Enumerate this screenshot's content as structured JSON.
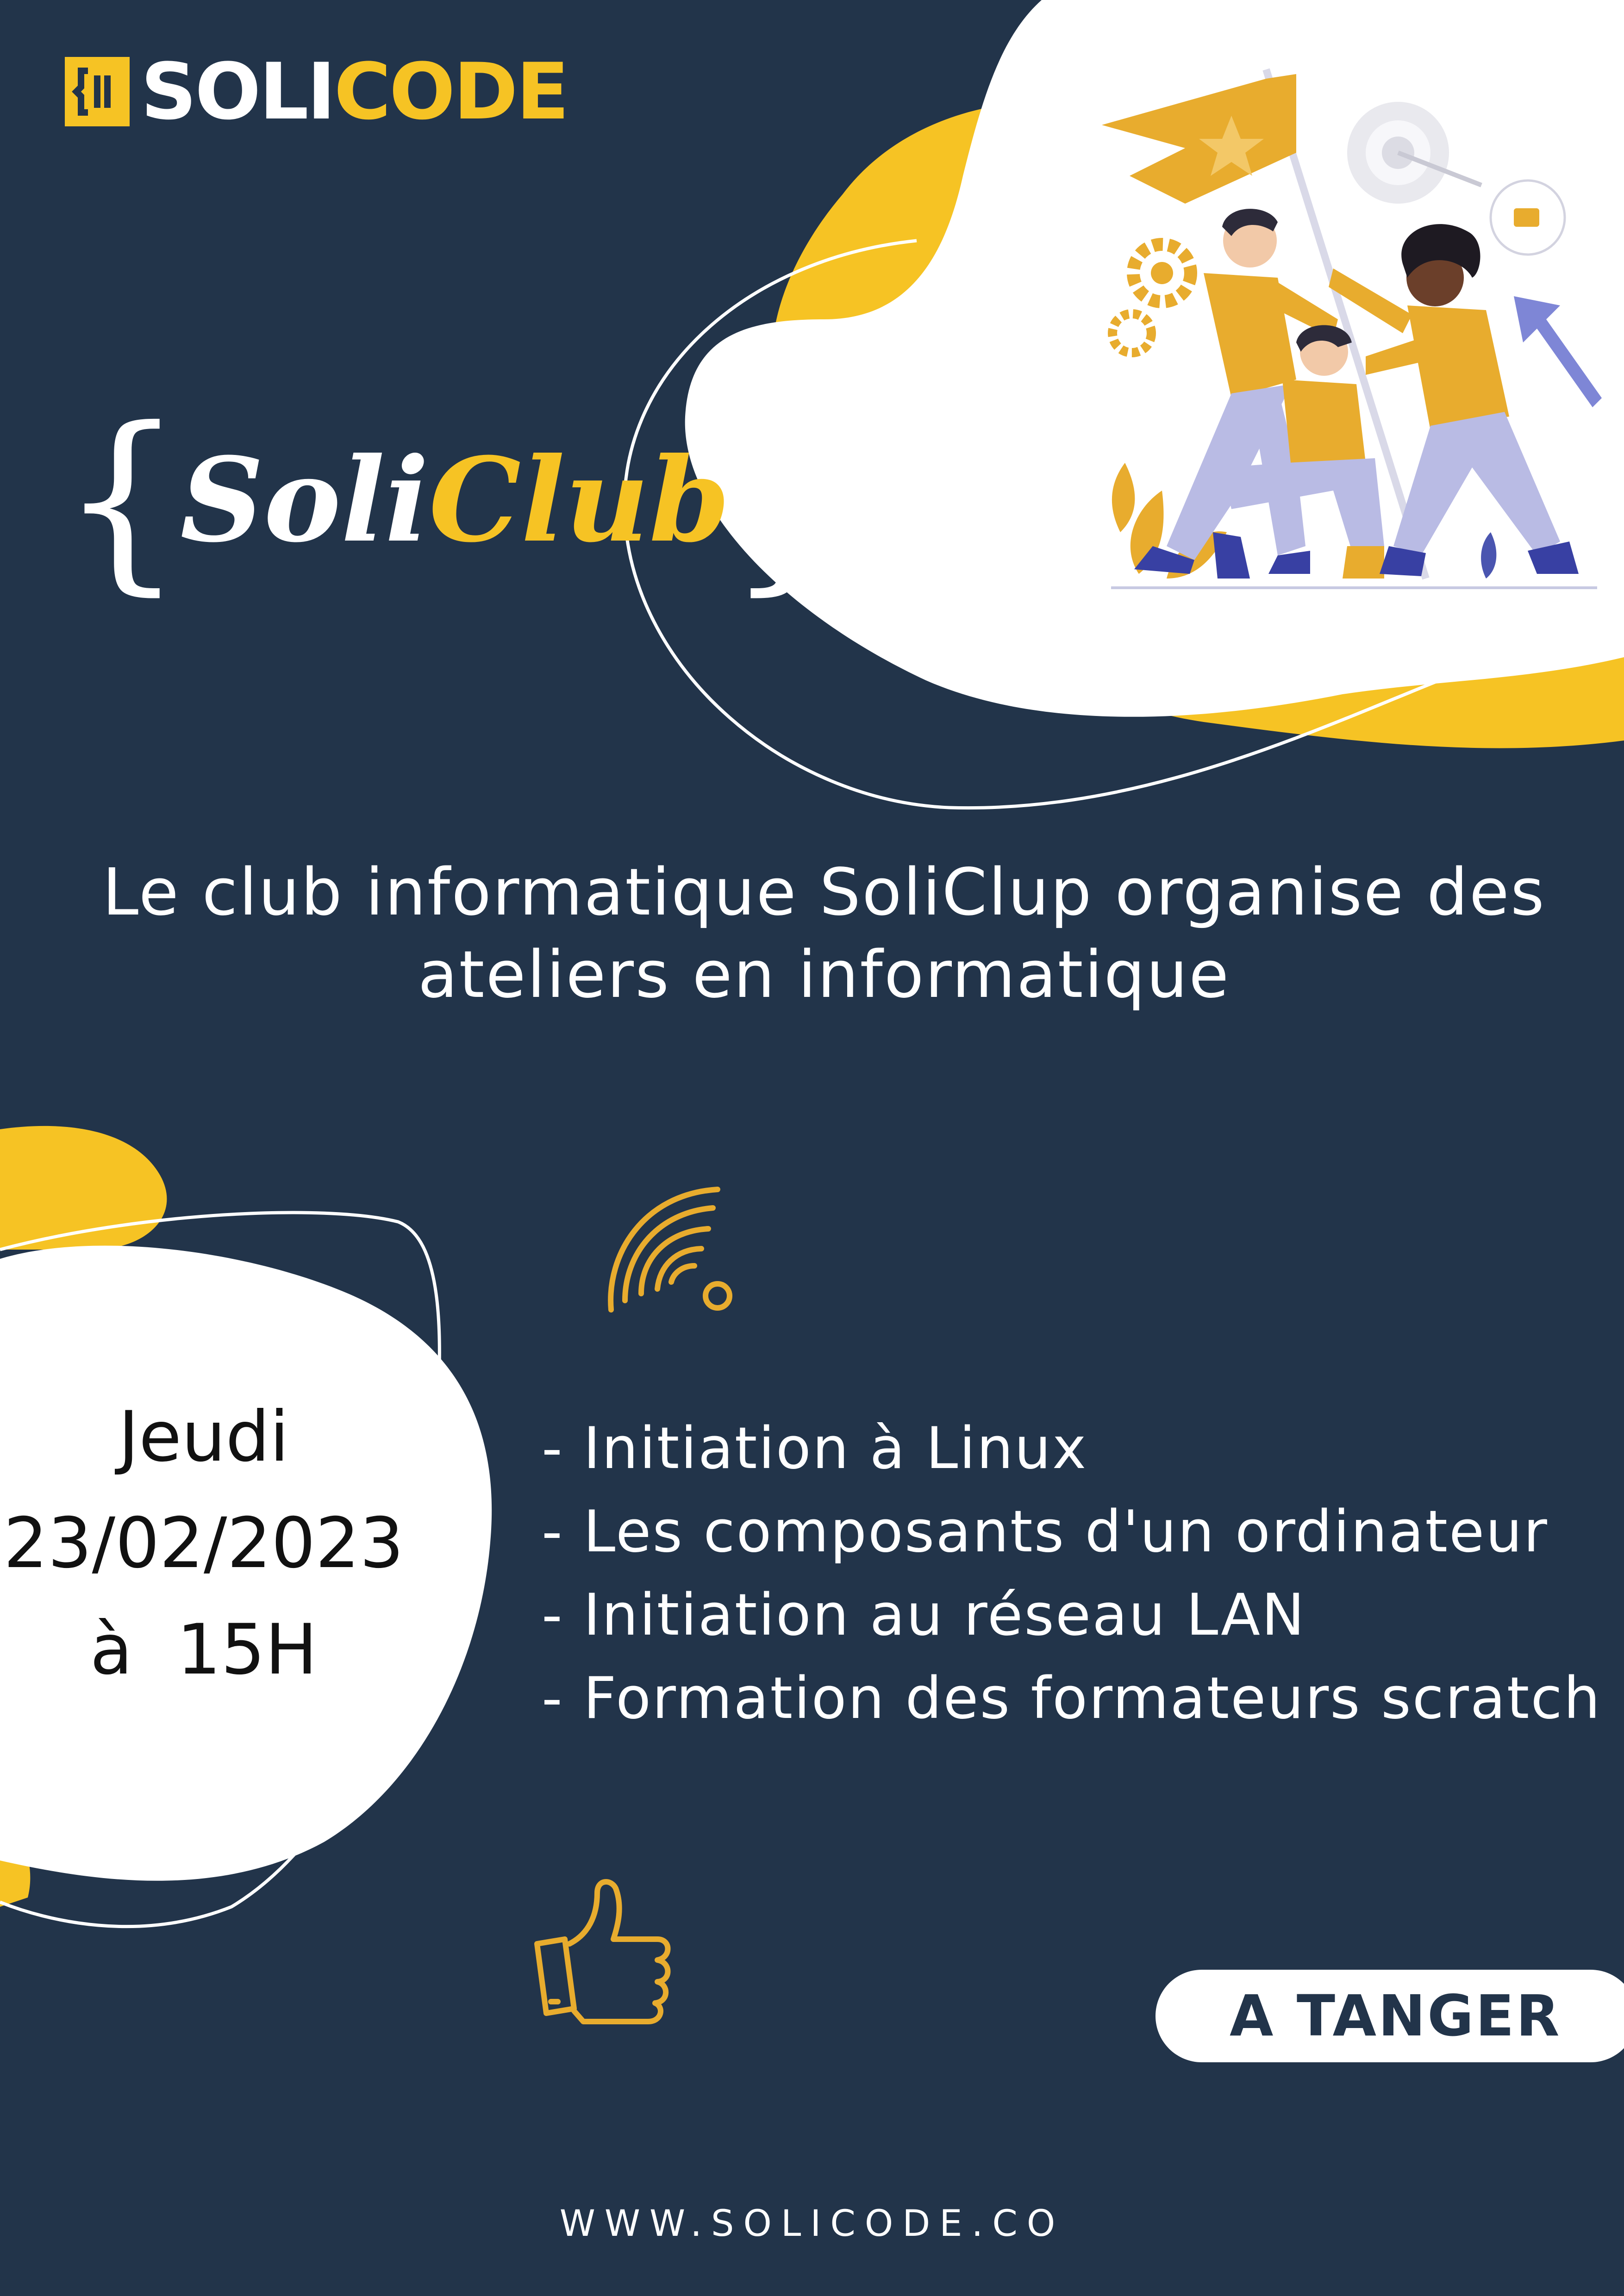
{
  "brand": {
    "logo_soli": "SOLI",
    "logo_code": "CODE",
    "primary_color": "#22344a",
    "accent_color": "#f6c324"
  },
  "club": {
    "brace_open": "{",
    "name_part1": "Soli",
    "name_part2": "Club",
    "brace_close": "}"
  },
  "intro": {
    "line1": "Le club informatique SoliClup organise des",
    "line2": "ateliers en informatique"
  },
  "event": {
    "day": "Jeudi",
    "date": "23/02/2023",
    "time": "à  15H"
  },
  "topics": [
    "- Initiation à Linux",
    "- Les composants d'un ordinateur",
    "- Initiation au réseau LAN",
    "- Formation des formateurs scratch"
  ],
  "location": "A TANGER",
  "website": "WWW.SOLICODE.CO",
  "icons": [
    "wifi-icon",
    "thumbs-up-icon",
    "team-flag-illustration",
    "gear-icon",
    "target-icon",
    "arrow-up-icon"
  ]
}
